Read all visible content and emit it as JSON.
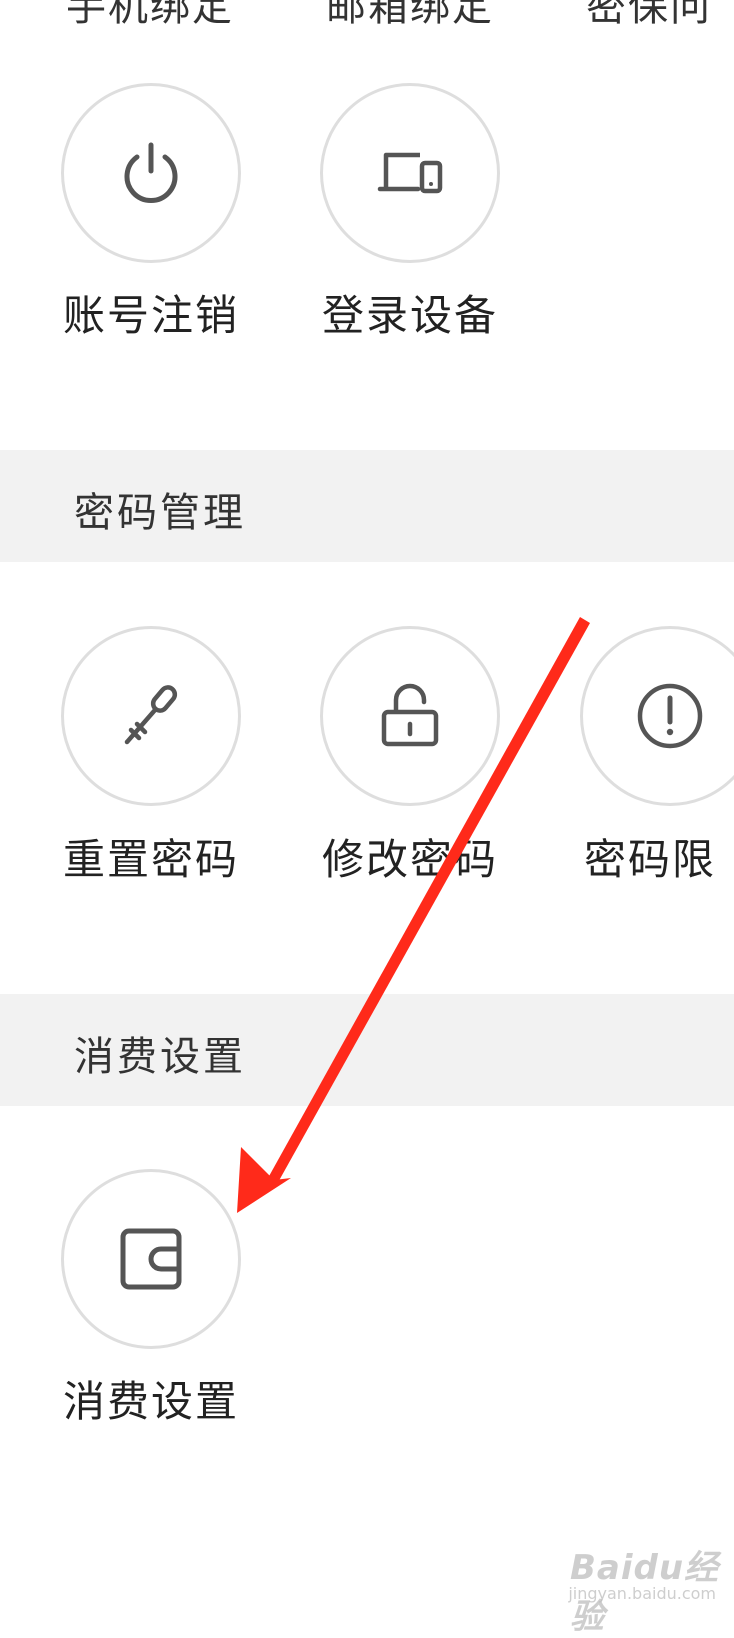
{
  "top_row": {
    "labels": [
      "手机绑定",
      "邮箱绑定",
      "密保问"
    ]
  },
  "account_items": [
    {
      "label": "账号注销",
      "icon": "power-icon"
    },
    {
      "label": "登录设备",
      "icon": "devices-icon"
    }
  ],
  "password_section": {
    "title": "密码管理",
    "items": [
      {
        "label": "重置密码",
        "icon": "key-icon"
      },
      {
        "label": "修改密码",
        "icon": "lock-icon"
      },
      {
        "label": "密码限",
        "icon": "alert-circle-icon"
      }
    ]
  },
  "consumption_section": {
    "title": "消费设置",
    "items": [
      {
        "label": "消费设置",
        "icon": "wallet-icon"
      }
    ]
  },
  "annotation": {
    "arrow_color": "#ff2a1a"
  },
  "watermark": {
    "brand": "Baidu经验",
    "url": "jingyan.baidu.com"
  },
  "colors": {
    "icon": "#555555",
    "circle_border": "#dedede",
    "section_bg": "#f2f2f2"
  }
}
